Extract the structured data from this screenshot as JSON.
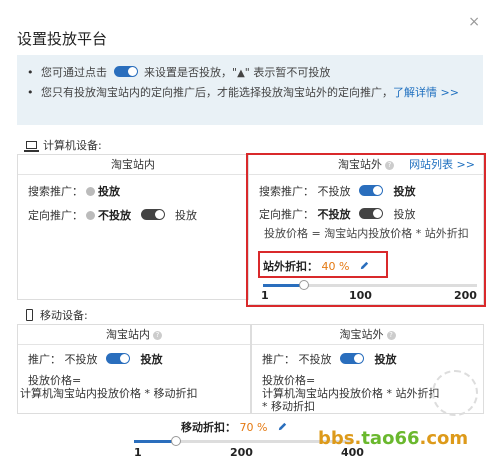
{
  "dialog": {
    "title": "设置投放平台",
    "close": "×"
  },
  "notice": {
    "line1_a": "您可通过点击",
    "line1_b": "来设置是否投放，\"",
    "line1_warn": "▲",
    "line1_c": "\" 表示暂不可投放",
    "line2_a": "您只有投放淘宝站内的定向推广后，才能选择投放淘宝站外的定向推广，",
    "line2_link": "了解详情 >>"
  },
  "pc": {
    "section_label": "计算机设备:",
    "inside": {
      "head": "淘宝站内",
      "search_label": "搜索推广：",
      "search_value": "投放",
      "target_label": "定向推广：",
      "target_off": "不投放",
      "target_on": "投放"
    },
    "outside": {
      "head": "淘宝站外",
      "site_list_link": "网站列表 >>",
      "search_label": "搜索推广：",
      "search_off": "不投放",
      "search_on": "投放",
      "target_label": "定向推广：",
      "target_off": "不投放",
      "target_on": "投放",
      "price_formula": "投放价格 = 淘宝站内投放价格 * 站外折扣",
      "discount_label": "站外折扣：",
      "discount_value": "40 %",
      "slider_min": "1",
      "slider_mid": "100",
      "slider_max": "200",
      "slider_value": 40
    }
  },
  "mobile": {
    "section_label": "移动设备:",
    "inside": {
      "head": "淘宝站内",
      "promo_label": "推广：",
      "promo_off": "不投放",
      "promo_on": "投放",
      "price_line1": "投放价格=",
      "price_line2": "计算机淘宝站内投放价格 * 移动折扣"
    },
    "outside": {
      "head": "淘宝站外",
      "promo_label": "推广：",
      "promo_off": "不投放",
      "promo_on": "投放",
      "price_line1": "投放价格=",
      "price_line2": "计算机淘宝站内投放价格 * 站外折扣",
      "price_line3": "* 移动折扣"
    },
    "discount_label": "移动折扣：",
    "discount_value": "70 %",
    "slider_min": "1",
    "slider_mid": "200",
    "slider_max": "400",
    "slider_value": 70
  },
  "watermark": {
    "prefix": "bbs.",
    "site": "tao66",
    "suffix": ".com"
  },
  "colors": {
    "accent": "#2a6ebd",
    "highlight_border": "#d9292b",
    "discount_text": "#e47911",
    "notice_bg": "#e9f1f6"
  }
}
